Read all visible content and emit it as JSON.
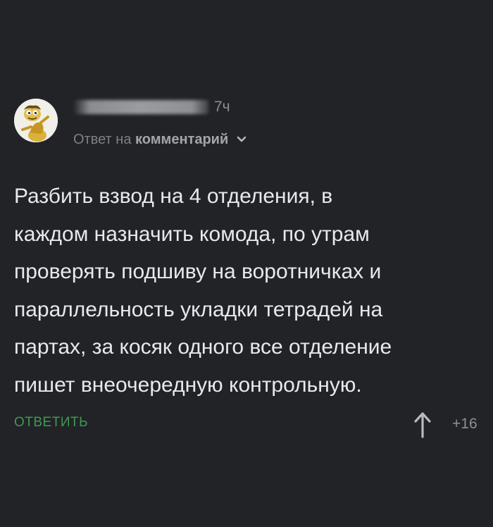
{
  "comment": {
    "author_redacted": true,
    "timestamp": "7ч",
    "reply_prefix": "Ответ на",
    "reply_target": "комментарий",
    "body": "Разбить взвод на 4 отделения, в\nкаждом назначить комода, по утрам\nпроверять подшиву на воротничках и\nпараллельность укладки тетрадей на\nпартах, за косяк одного все отделение\nпишет внеочередную контрольную.",
    "reply_button_label": "ОТВЕТИТЬ",
    "rating": "+16",
    "icons": {
      "avatar": "avatar-image",
      "reply_chevron": "chevron-down-icon",
      "upvote": "arrow-up-icon"
    }
  },
  "colors": {
    "background": "#222327",
    "reply_accent": "#3e9a50",
    "body_text": "#e9e9ec",
    "meta_text": "#8d8f95"
  }
}
